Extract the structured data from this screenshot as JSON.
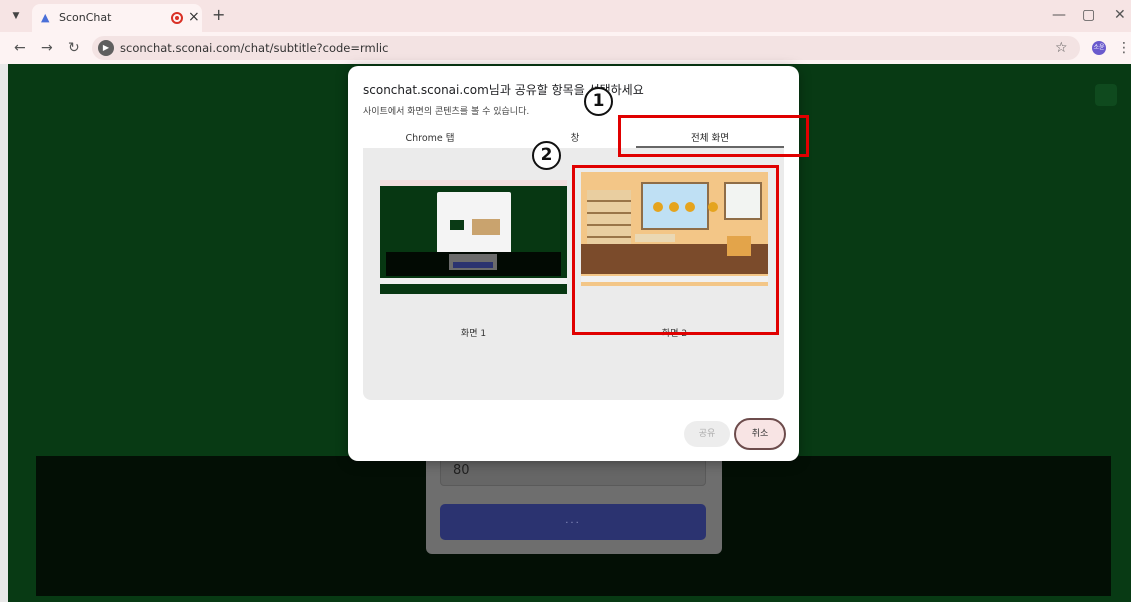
{
  "browser": {
    "tab_title": "SconChat",
    "url": "sconchat.sconai.com/chat/subtitle?code=rmlic",
    "avatar_initials": "소윤"
  },
  "background_app": {
    "input_value": "80",
    "button_label": "..."
  },
  "dialog": {
    "title": "sconchat.sconai.com님과 공유할 항목을 선택하세요",
    "subtitle": "사이트에서 화면의 콘텐츠를 볼 수 있습니다.",
    "tabs": [
      {
        "label": "Chrome 탭",
        "active": false
      },
      {
        "label": "창",
        "active": false
      },
      {
        "label": "전체 화면",
        "active": true
      }
    ],
    "screens": [
      {
        "label": "화면 1"
      },
      {
        "label": "화면 2"
      }
    ],
    "share_label": "공유",
    "cancel_label": "취소"
  },
  "annotations": [
    {
      "number": "1",
      "target": "전체 화면 tab"
    },
    {
      "number": "2",
      "target": "화면 2"
    }
  ],
  "colors": {
    "annotation_red": "#e00000",
    "page_background": "#083a14",
    "accent_button": "#2b3370"
  }
}
